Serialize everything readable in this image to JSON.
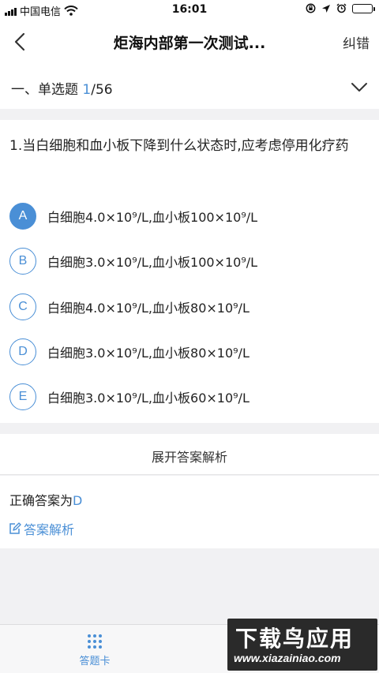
{
  "status_bar": {
    "carrier": "中国电信",
    "time": "16:01"
  },
  "nav": {
    "title": "炬海内部第一次测试...",
    "report_label": "纠错"
  },
  "section": {
    "prefix": "一、单选题 ",
    "current": "1",
    "total": "/56"
  },
  "question": {
    "stem": "1.当白细胞和血小板下降到什么状态时,应考虑停用化疗药",
    "options": [
      {
        "letter": "A",
        "text": "白细胞4.0×10⁹/L,血小板100×10⁹/L",
        "selected": true
      },
      {
        "letter": "B",
        "text": "白细胞3.0×10⁹/L,血小板100×10⁹/L",
        "selected": false
      },
      {
        "letter": "C",
        "text": "白细胞4.0×10⁹/L,血小板80×10⁹/L",
        "selected": false
      },
      {
        "letter": "D",
        "text": "白细胞3.0×10⁹/L,血小板80×10⁹/L",
        "selected": false
      },
      {
        "letter": "E",
        "text": "白细胞3.0×10⁹/L,血小板60×10⁹/L",
        "selected": false
      }
    ]
  },
  "expand_label": "展开答案解析",
  "answer": {
    "correct_prefix": "正确答案为",
    "correct_value": "D",
    "analysis_label": "答案解析"
  },
  "bottom": {
    "answer_card_label": "答题卡"
  },
  "watermark": {
    "big": "下载鸟应用",
    "small": "www.xiazainiao.com"
  },
  "colors": {
    "accent": "#4a8fd6",
    "page_bg": "#f1f1f3"
  }
}
